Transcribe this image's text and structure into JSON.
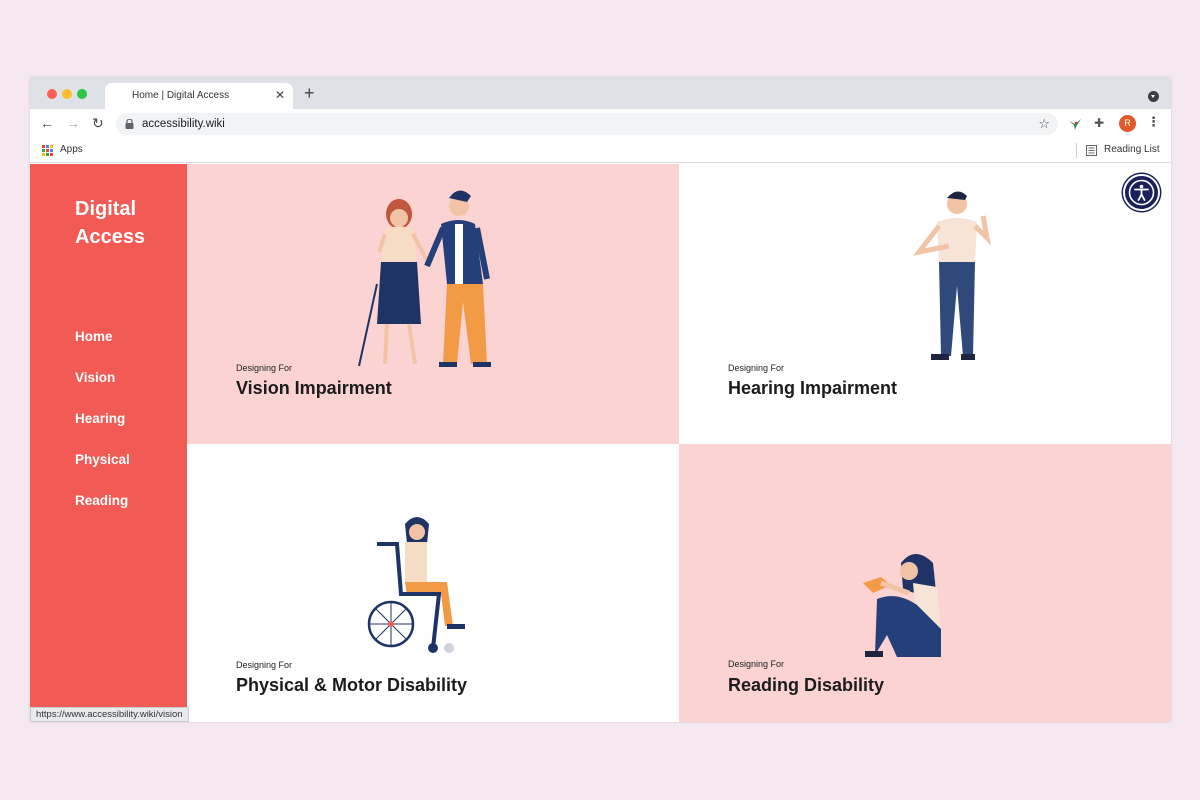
{
  "browser": {
    "tab_title": "Home | Digital Access",
    "tab_close": "✕",
    "new_tab": "+",
    "url": "accessibility.wiki",
    "profile_initial": "R",
    "bookmarks": {
      "apps_label": "Apps",
      "reading_list_label": "Reading List"
    },
    "status_url": "https://www.accessibility.wiki/vision"
  },
  "site": {
    "logo_line1": "Digital",
    "logo_line2": "Access",
    "nav": [
      "Home",
      "Vision",
      "Hearing",
      "Physical",
      "Reading"
    ],
    "panels": [
      {
        "overline": "Designing For",
        "title": "Vision Impairment"
      },
      {
        "overline": "Designing For",
        "title": "Hearing Impairment"
      },
      {
        "overline": "Designing For",
        "title": "Physical & Motor Disability"
      },
      {
        "overline": "Designing For",
        "title": "Reading Disability"
      }
    ]
  },
  "colors": {
    "sidebar": "#f25a55",
    "panel_pink": "#fbd3d2",
    "navy": "#1f3466",
    "orange": "#f29a45",
    "a11y_button": "#1a1f5e"
  },
  "icons": {
    "back": "arrow-left-icon",
    "forward": "arrow-right-icon",
    "reload": "reload-icon",
    "lock": "lock-icon",
    "star": "star-icon",
    "extension": "puzzle-icon",
    "menu": "kebab-icon",
    "accessibility": "accessibility-icon"
  }
}
